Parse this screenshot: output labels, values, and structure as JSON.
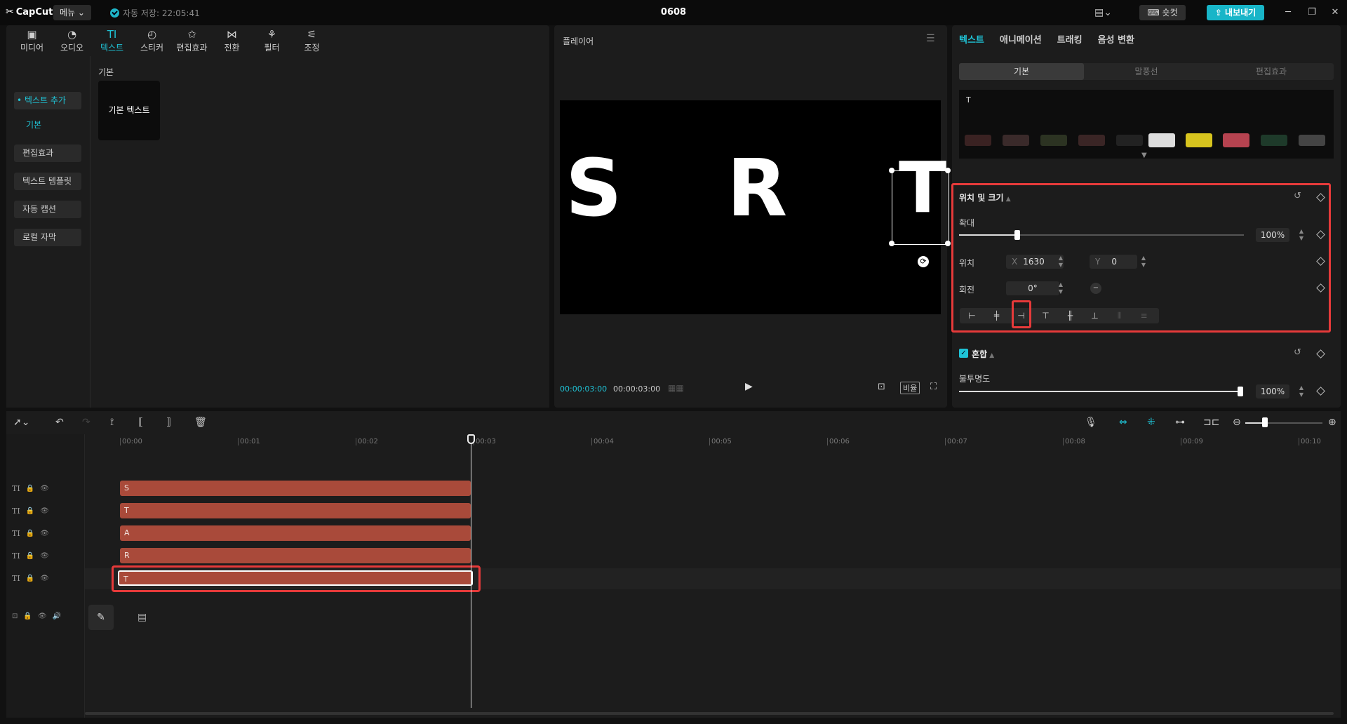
{
  "titlebar": {
    "logo": "CapCut",
    "menu": "메뉴",
    "autosave": "자동 저장: 22:05:41",
    "doc_title": "0608",
    "shortcut": "숏컷",
    "export": "내보내기",
    "minimize": "─",
    "restore": "❐",
    "close": "✕"
  },
  "toolbar": {
    "items": [
      {
        "icon": "▣",
        "label": "미디어"
      },
      {
        "icon": "◔",
        "label": "오디오"
      },
      {
        "icon": "TI",
        "label": "텍스트"
      },
      {
        "icon": "◴",
        "label": "스티커"
      },
      {
        "icon": "✩",
        "label": "편집효과"
      },
      {
        "icon": "⋈",
        "label": "전환"
      },
      {
        "icon": "⚘",
        "label": "필터"
      },
      {
        "icon": "⚟",
        "label": "조정"
      }
    ]
  },
  "sidebar": {
    "add_text": "• 텍스트 추가",
    "basic": "기본",
    "effects": "편집효과",
    "templates": "텍스트 템플릿",
    "auto_caption": "자동 캡션",
    "local_caption": "로컬 자막"
  },
  "content": {
    "section": "기본",
    "card": "기본 텍스트"
  },
  "player": {
    "title": "플레이어",
    "current_time": "00:00:03:00",
    "total_time": "00:00:03:00",
    "ratio": "비율",
    "glyph_s": "S",
    "glyph_r": "R",
    "glyph_t": "T"
  },
  "right": {
    "tabs": [
      "텍스트",
      "애니메이션",
      "트래킹",
      "음성 변환"
    ],
    "seg": [
      "기본",
      "말풍선",
      "편집효과"
    ],
    "preset_label": "T",
    "position_size": "위치 및 크기",
    "scale_label": "확대",
    "scale_value": "100%",
    "position_label": "위치",
    "x_label": "X",
    "x_value": "1630",
    "y_label": "Y",
    "y_value": "0",
    "rotation_label": "회전",
    "rotation_value": "0°",
    "blend": "혼합",
    "opacity_label": "불투명도",
    "opacity_value": "100%"
  },
  "timeline": {
    "ticks": [
      "00:00",
      "00:01",
      "00:02",
      "00:03",
      "00:04",
      "00:05",
      "00:06",
      "00:07",
      "00:08",
      "00:09",
      "00:10"
    ],
    "clips": [
      "S",
      "T",
      "A",
      "R",
      "T"
    ]
  },
  "colors": {
    "accent": "#1fc3d6",
    "clip": "#a94a3a",
    "highlight": "#e63a3a"
  }
}
